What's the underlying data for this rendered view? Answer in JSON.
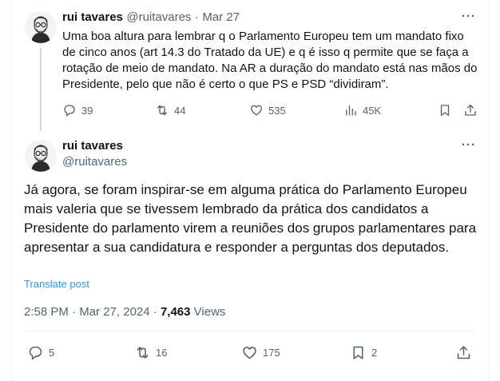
{
  "tweet1": {
    "author_name": "rui tavares",
    "handle": "@ruitavares",
    "separator": "·",
    "date": "Mar 27",
    "more_label": "···",
    "text": "Uma boa altura para lembrar q o Parlamento Europeu tem um mandato fixo de cinco anos (art 14.3 do Tratado da UE) e q é isso q permite que se faça a rotação de meio de mandato. Na AR a duração do mandato está nas mãos do Presidente, pelo que não é certo o que PS e PSD “dividiram”.",
    "replies": "39",
    "reposts": "44",
    "likes": "535",
    "views": "45K"
  },
  "tweet2": {
    "author_name": "rui tavares",
    "handle": "@ruitavares",
    "more_label": "···",
    "text": "Já agora, se foram inspirar-se em alguma prática do Parlamento Europeu mais valeria que se tivessem lembrado da prática dos candidatos a Presidente do parlamento virem a reuniões dos grupos parlamentares para apresentar a sua candidatura e responder a perguntas dos deputados.",
    "translate_label": "Translate post",
    "time": "2:58 PM",
    "dot": "·",
    "date": "Mar 27, 2024",
    "views_count": "7,463",
    "views_label": "Views",
    "replies": "5",
    "reposts": "16",
    "likes": "175",
    "bookmarks": "2"
  },
  "colors": {
    "text": "#0f1419",
    "muted": "#536471",
    "link": "#1d9bf0",
    "border": "#eff3f4"
  }
}
